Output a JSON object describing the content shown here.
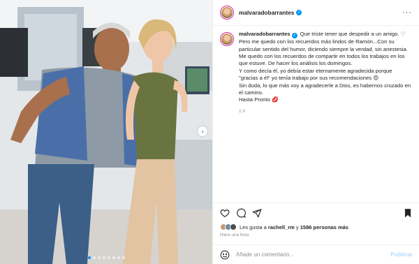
{
  "post": {
    "username": "malvaradobarrantes",
    "verified_mark": "✓",
    "more_label": "···",
    "photo": {
      "slide_count": 8,
      "active_slide": 1,
      "next_label": "›"
    }
  },
  "caption": {
    "username": "malvaradobarrantes",
    "lines": [
      "Que triste tener que despedir a un amigo. ♡",
      "Pero me quedo con los recuerdos más lindos de Ramón...Con su particular sentido del humor, diciendo siempre la verdad, sin anestesia. Me quedo con los recuerdos de compartir en todos los trabajos en los que estuve. De hacer los análisis los domingos.",
      "Y como decía él, yo debía estar eternamente agradecida porque \"gracias a él\" yo tenía trabajo por sus recomendaciones 😍",
      "Sin duda, lo que más voy a agradecerle a Dios, es habernos cruzado en el camino.",
      "Hasta Pronto 💋"
    ],
    "time": "1 h"
  },
  "actions": {
    "like_icon": "heart-icon",
    "comment_icon": "comment-icon",
    "share_icon": "share-icon",
    "save_icon": "bookmark-icon"
  },
  "likes": {
    "prefix": "Les gusta a",
    "user": "rachell_rm",
    "connector": "y",
    "others": "1586 personas más"
  },
  "posted_ago": "Hace una hora",
  "comment_box": {
    "placeholder": "Añade un comentario...",
    "publish_label": "Publicar",
    "emoji_icon": "smiley-icon"
  },
  "colors": {
    "accent": "#0095f6",
    "publish_disabled": "#b3dbff",
    "muted": "#8e8e8e",
    "text": "#262626"
  }
}
